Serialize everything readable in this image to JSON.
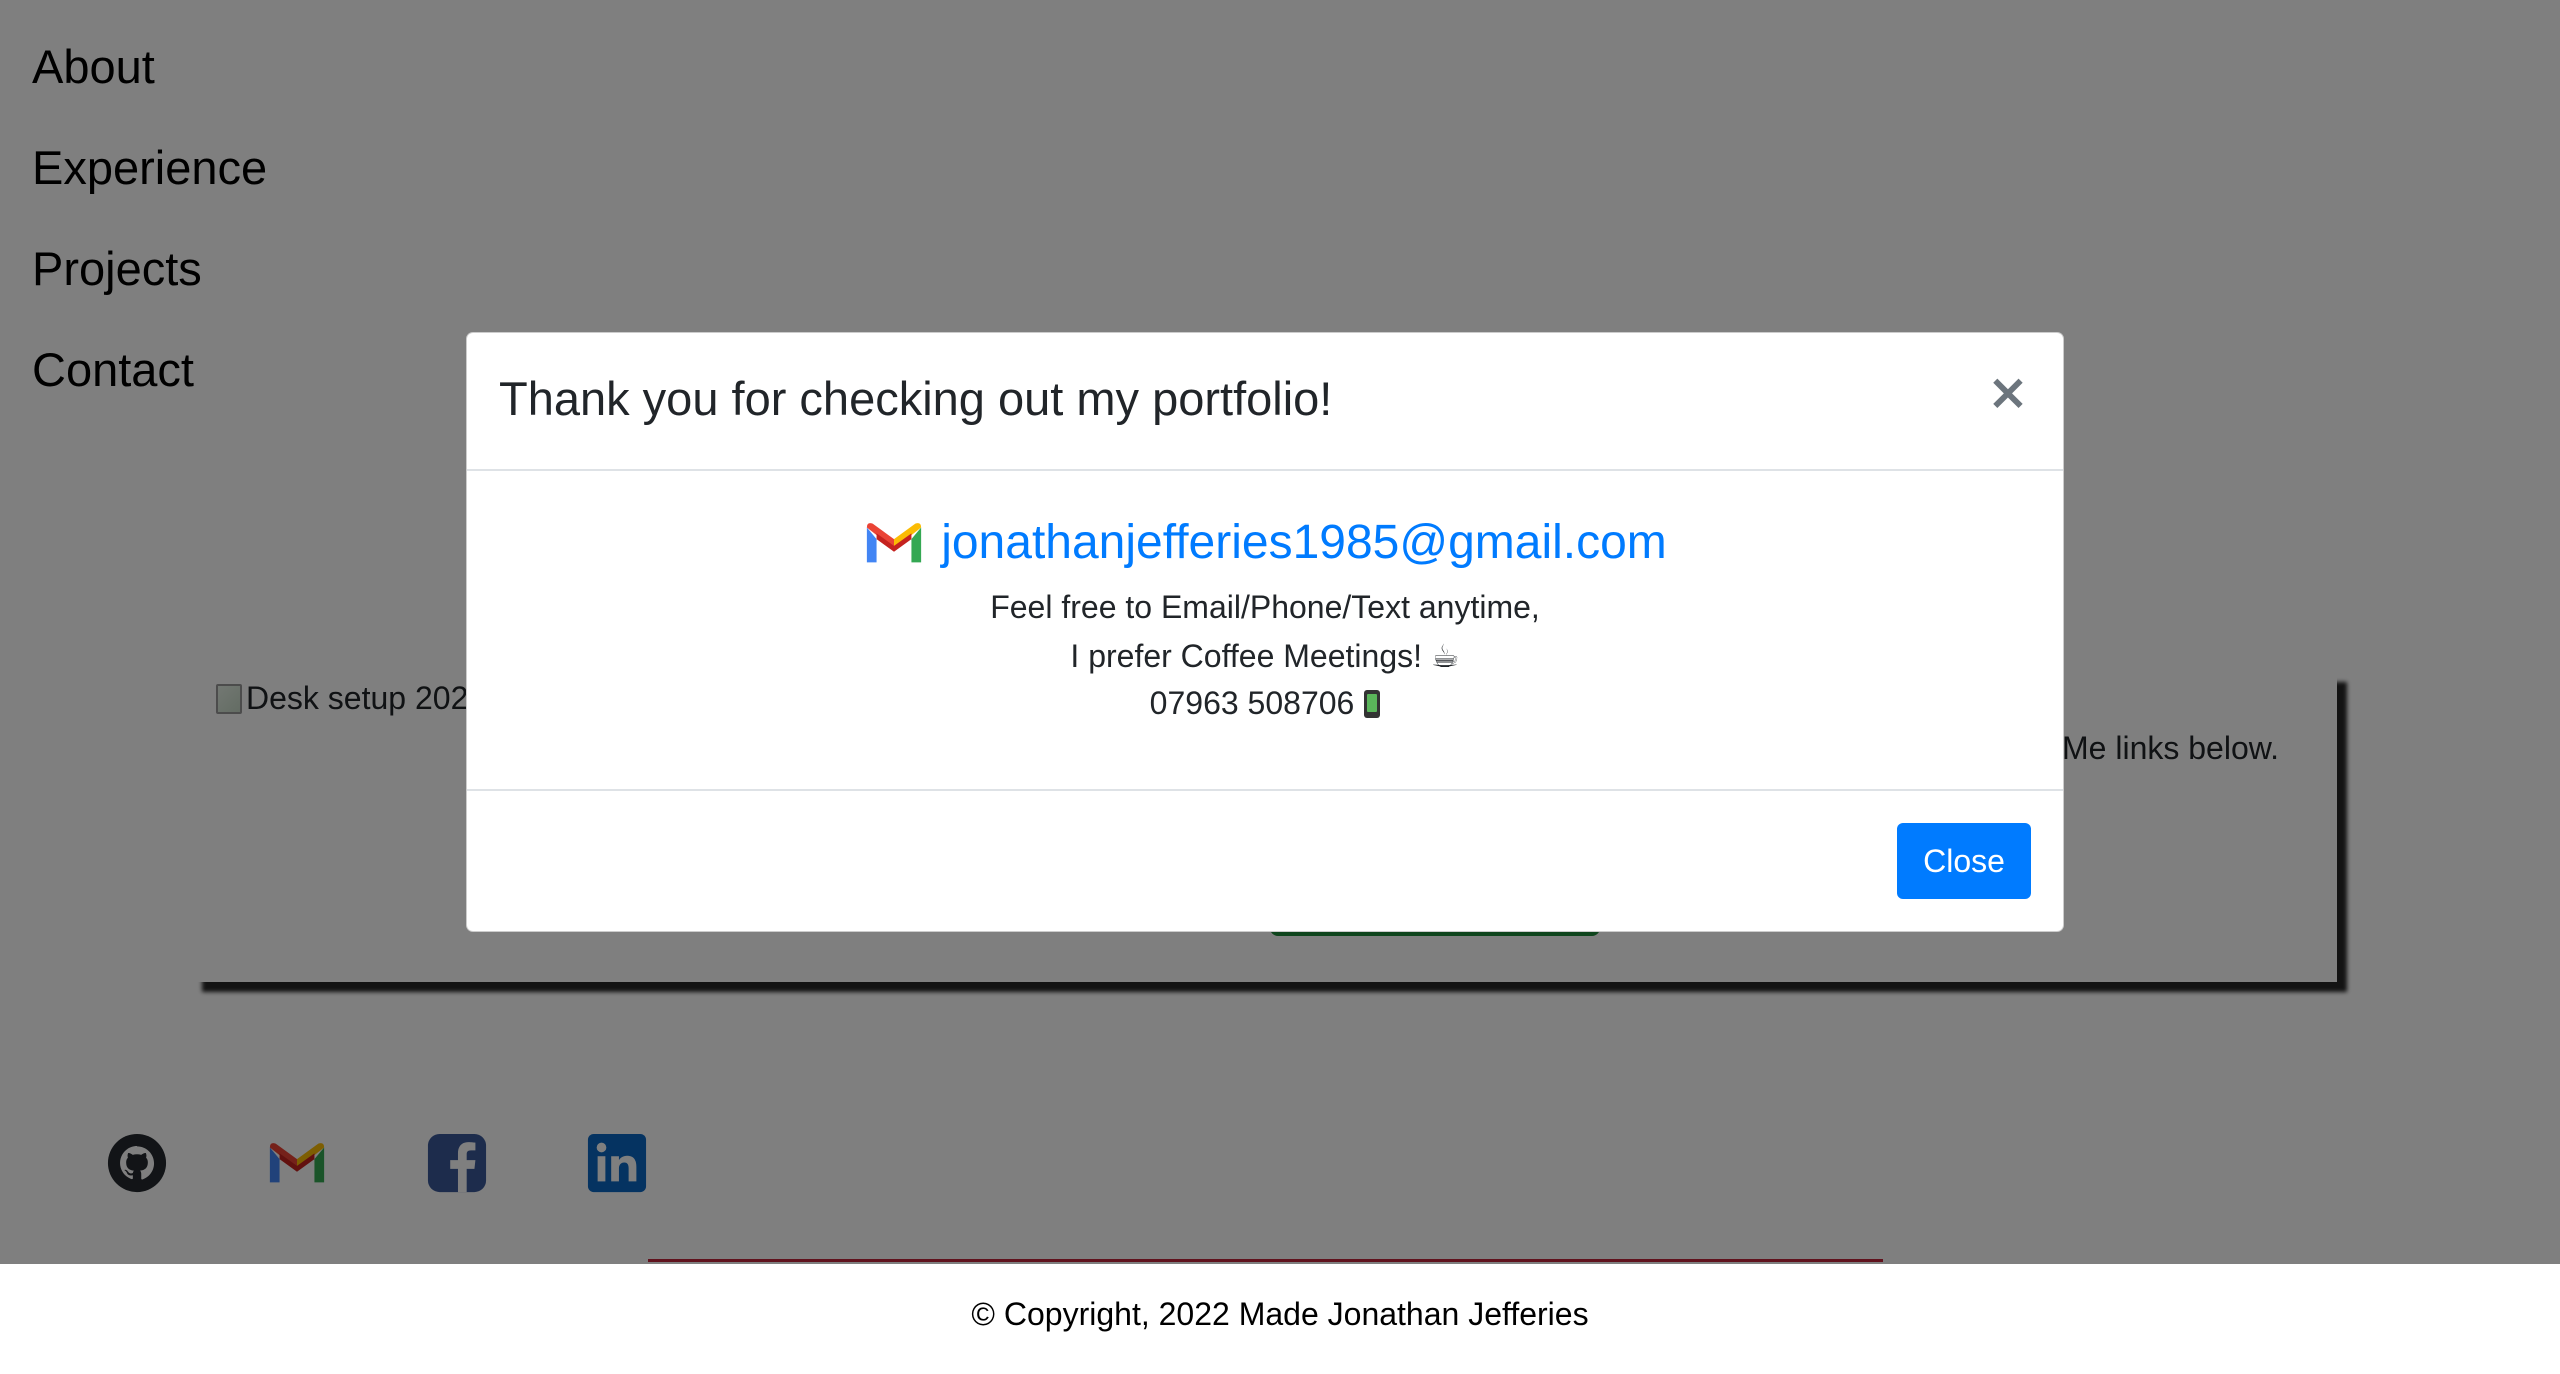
{
  "nav": {
    "items": [
      "About",
      "Experience",
      "Projects",
      "Contact"
    ]
  },
  "card": {
    "image_alt": "Desk setup 202",
    "text_fragment": "Me links below."
  },
  "socials": {
    "icons": [
      "github-icon",
      "gmail-icon",
      "facebook-icon",
      "linkedin-icon"
    ]
  },
  "footer": {
    "copyright": "© Copyright, 2022 Made Jonathan Jefferies"
  },
  "modal": {
    "title": "Thank you for checking out my portfolio!",
    "close_symbol": "×",
    "email": "jonathanjefferies1985@gmail.com",
    "line1": "Feel free to Email/Phone/Text anytime,",
    "line2": "I prefer Coffee Meetings! ☕",
    "phone": "07963 508706",
    "close_label": "Close"
  },
  "colors": {
    "link": "#007bff",
    "button": "#007bff",
    "backdrop": "rgba(0,0,0,0.5)",
    "footer_line": "#c0253b"
  }
}
